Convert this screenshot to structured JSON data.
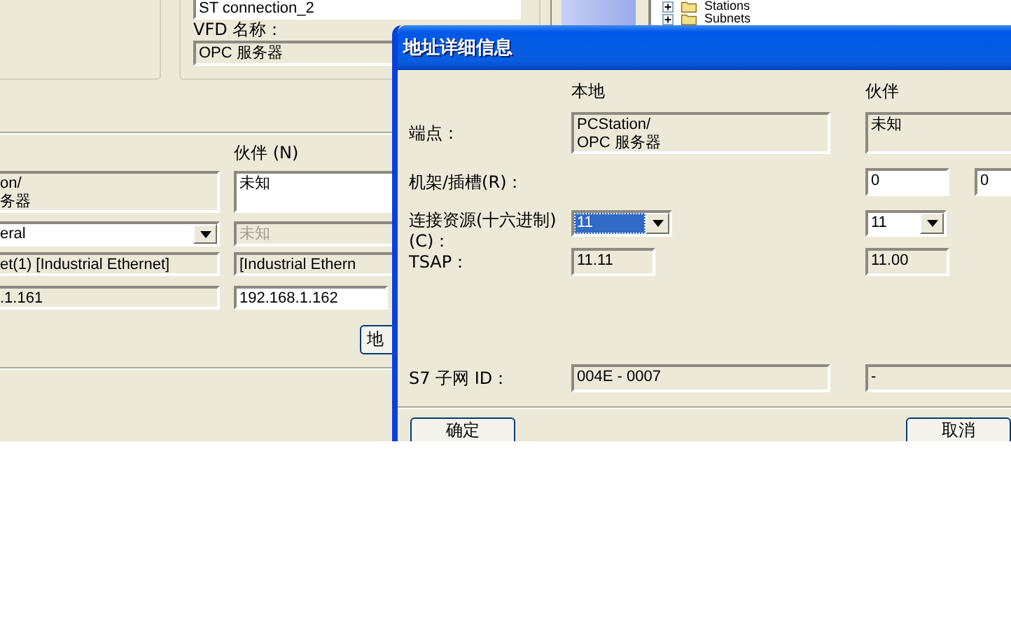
{
  "background_window": {
    "connection_name": "ST connection_2",
    "vfd_label": "VFD 名称：",
    "vfd_name": "OPC 服务器",
    "tree": {
      "items": [
        {
          "label": "Stations",
          "expanded": false
        },
        {
          "label": "Subnets",
          "expanded": false
        }
      ]
    },
    "partner_heading": "伙伴 (N)",
    "local_endpoint": "on/\n务器",
    "partner_endpoint": "未知",
    "local_interface": "eral",
    "partner_interface": {
      "text": "未知",
      "disabled": true
    },
    "local_subnet": "et(1) [Industrial Ethernet]",
    "partner_subnet": "[Industrial Ethern",
    "local_address": ".1.161",
    "partner_address": "192.168.1.162",
    "address_button": "地"
  },
  "dialog": {
    "title": "地址详细信息",
    "local_heading": "本地",
    "partner_heading": "伙伴",
    "rows": [
      {
        "kind": "multiline",
        "label": "端点：",
        "local": "PCStation/\nOPC 服务器",
        "partner": [
          "未知"
        ]
      },
      {
        "kind": "inputs",
        "label": "机架/插槽(R)：",
        "partner": [
          "0",
          "0"
        ]
      },
      {
        "kind": "combo",
        "label": "连接资源(十六进制)\n(C)：",
        "local": {
          "value": "11",
          "selected": true
        },
        "partner": {
          "value": "11",
          "selected": false
        }
      },
      {
        "kind": "readonly",
        "label": "TSAP：",
        "local": "11.11",
        "partner": [
          "11.00"
        ]
      },
      {
        "kind": "spacer"
      },
      {
        "kind": "readonly_wide",
        "label": "S7 子网 ID：",
        "local": "004E - 0007",
        "partner": [
          "-"
        ]
      }
    ],
    "buttons": [
      "确定",
      "取消"
    ]
  }
}
